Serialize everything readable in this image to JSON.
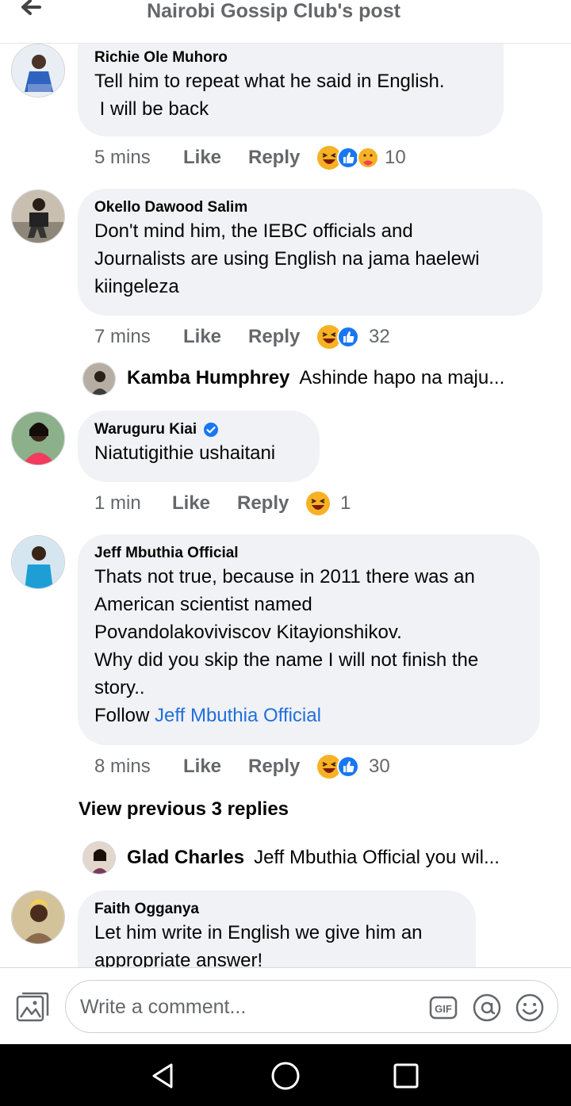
{
  "header": {
    "title": "Nairobi Gossip Club's post",
    "back_icon": "arrow-left-icon"
  },
  "comments": [
    {
      "author": "Richie Ole Muhoro",
      "text": "Tell him to repeat what he said in English.\n I will be back",
      "time": "5 mins",
      "like_label": "Like",
      "reply_label": "Reply",
      "reactions": [
        "haha-icon",
        "like-icon",
        "care-icon"
      ],
      "reaction_count": "10"
    },
    {
      "author": "Okello Dawood Salim",
      "text": "Don't mind him, the IEBC officials and\nJournalists are using English na jama haelewi\nkiingeleza",
      "time": "7 mins",
      "like_label": "Like",
      "reply_label": "Reply",
      "reactions": [
        "haha-icon",
        "like-icon"
      ],
      "reaction_count": "32",
      "reply_preview": {
        "name": "Kamba Humphrey",
        "text": "Ashinde hapo na maju..."
      }
    },
    {
      "author": "Waruguru Kiai",
      "verified": true,
      "text": "Niatutigithie ushaitani",
      "time": "1 min",
      "like_label": "Like",
      "reply_label": "Reply",
      "reactions": [
        "haha-icon"
      ],
      "reaction_count": "1"
    },
    {
      "author": "Jeff Mbuthia Official",
      "text": "Thats not true, because in 2011 there was an\nAmerican scientist named\nPovandolakoviviscov Kitayionshikov.\nWhy did you skip the name I will not finish the\nstory..",
      "follow_prefix": "Follow ",
      "follow_link": "Jeff Mbuthia Official",
      "time": "8 mins",
      "like_label": "Like",
      "reply_label": "Reply",
      "reactions": [
        "haha-icon",
        "like-icon"
      ],
      "reaction_count": "30",
      "view_previous": "View previous 3 replies",
      "reply_preview": {
        "name": "Glad Charles",
        "text": "Jeff Mbuthia Official you wil..."
      }
    },
    {
      "author": "Faith Ogganya",
      "text": "Let him write in English we give him an\nappropriate answer!"
    }
  ],
  "composer": {
    "placeholder": "Write a comment...",
    "icons": [
      "photo-icon",
      "gif-icon",
      "mention-icon",
      "emoji-icon"
    ]
  },
  "navbar": {
    "icons": [
      "back-triangle-icon",
      "home-circle-icon",
      "recents-square-icon"
    ]
  },
  "colors": {
    "bubble": "#f0f2f5",
    "link": "#216fdb",
    "muted": "#65676b",
    "like_blue": "#1877f2",
    "haha_yellow": "#f7b125"
  }
}
